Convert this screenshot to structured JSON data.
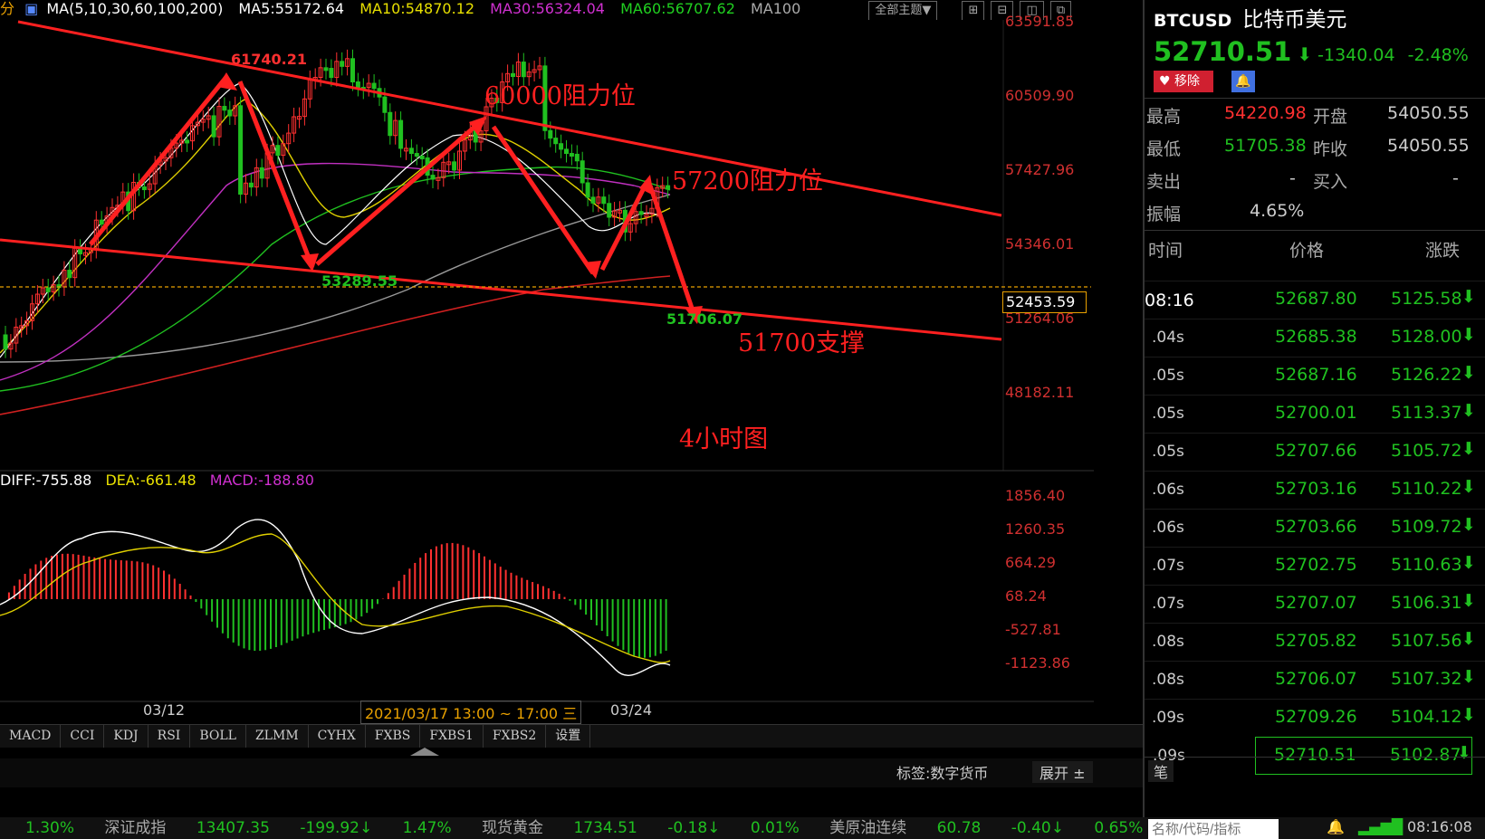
{
  "ma_bar": {
    "prefix": "分",
    "ma_label": "MA(5,10,30,60,100,200)",
    "ma5": "MA5:55172.64",
    "ma10": "MA10:54870.12",
    "ma30": "MA30:56324.04",
    "ma60": "MA60:56707.62",
    "ma100": "MA100",
    "theme_button": "全部主题▼",
    "colors": {
      "ma5": "#ffffff",
      "ma10": "#e8e000",
      "ma30": "#d030d0",
      "ma60": "#20d020",
      "ma100": "#aaaaaa"
    }
  },
  "price_axis": [
    "63591.85",
    "60509.90",
    "57427.96",
    "54346.01",
    "51264.06",
    "48182.11"
  ],
  "current_price_tag": "52453.59",
  "annotations": {
    "high": "61740.21",
    "low1": "53289.55",
    "low2": "51706.07",
    "res1": "60000阻力位",
    "res2": "57200阻力位",
    "support": "51700支撑",
    "timeframe": "4小时图"
  },
  "macd": {
    "diff": "DIFF:-755.88",
    "dea": "DEA:-661.48",
    "macd": "MACD:-188.80",
    "axis": [
      "1856.40",
      "1260.35",
      "664.29",
      "68.24",
      "-527.81",
      "-1123.86"
    ]
  },
  "date_axis": {
    "d1": "03/12",
    "range": "2021/03/17 13:00 ~ 17:00 三",
    "d2": "03/24"
  },
  "tabs": [
    "MACD",
    "CCI",
    "KDJ",
    "RSI",
    "BOLL",
    "ZLMM",
    "CYHX",
    "FXBS",
    "FXBS1",
    "FXBS2",
    "设置"
  ],
  "tag_bar": {
    "tag": "标签:数字货币",
    "expand": "展开 ±",
    "pen": "笔"
  },
  "panel": {
    "symbol": "BTCUSD",
    "name": "比特币美元",
    "price": "52710.51",
    "change": "-1340.04",
    "change_pct": "-2.48%",
    "remove_btn": "移除",
    "stats": [
      {
        "k1": "最高",
        "v1": "54220.98",
        "k2": "开盘",
        "v2": "54050.55"
      },
      {
        "k1": "最低",
        "v1": "51705.38",
        "k2": "昨收",
        "v2": "54050.55"
      },
      {
        "k1": "卖出",
        "v1": "-",
        "k2": "买入",
        "v2": "-"
      }
    ],
    "amp_label": "振幅",
    "amp_value": "4.65%",
    "tick_headers": {
      "time": "时间",
      "price": "价格",
      "chg": "涨跌"
    },
    "ticks": [
      {
        "t": "08:16",
        "p": "52687.80",
        "c": "5125.58"
      },
      {
        "t": ".04s",
        "p": "52685.38",
        "c": "5128.00"
      },
      {
        "t": ".05s",
        "p": "52687.16",
        "c": "5126.22"
      },
      {
        "t": ".05s",
        "p": "52700.01",
        "c": "5113.37"
      },
      {
        "t": ".05s",
        "p": "52707.66",
        "c": "5105.72"
      },
      {
        "t": ".06s",
        "p": "52703.16",
        "c": "5110.22"
      },
      {
        "t": ".06s",
        "p": "52703.66",
        "c": "5109.72"
      },
      {
        "t": ".07s",
        "p": "52702.75",
        "c": "5110.63"
      },
      {
        "t": ".07s",
        "p": "52707.07",
        "c": "5106.31"
      },
      {
        "t": ".08s",
        "p": "52705.82",
        "c": "5107.56"
      },
      {
        "t": ".08s",
        "p": "52706.07",
        "c": "5107.32"
      },
      {
        "t": ".09s",
        "p": "52709.26",
        "c": "5104.12"
      },
      {
        "t": ".09s",
        "p": "52710.51",
        "c": "5102.87"
      }
    ],
    "search_placeholder": "名称/代码/指标",
    "clock": "08:16:08"
  },
  "ticker": [
    "1.30%",
    "深证成指",
    "13407.35",
    "-199.92↓",
    "1.47%",
    "现货黄金",
    "1734.51",
    "-0.18↓",
    "0.01%",
    "美原油连续",
    "60.78",
    "-0.40↓",
    "0.65%"
  ]
}
